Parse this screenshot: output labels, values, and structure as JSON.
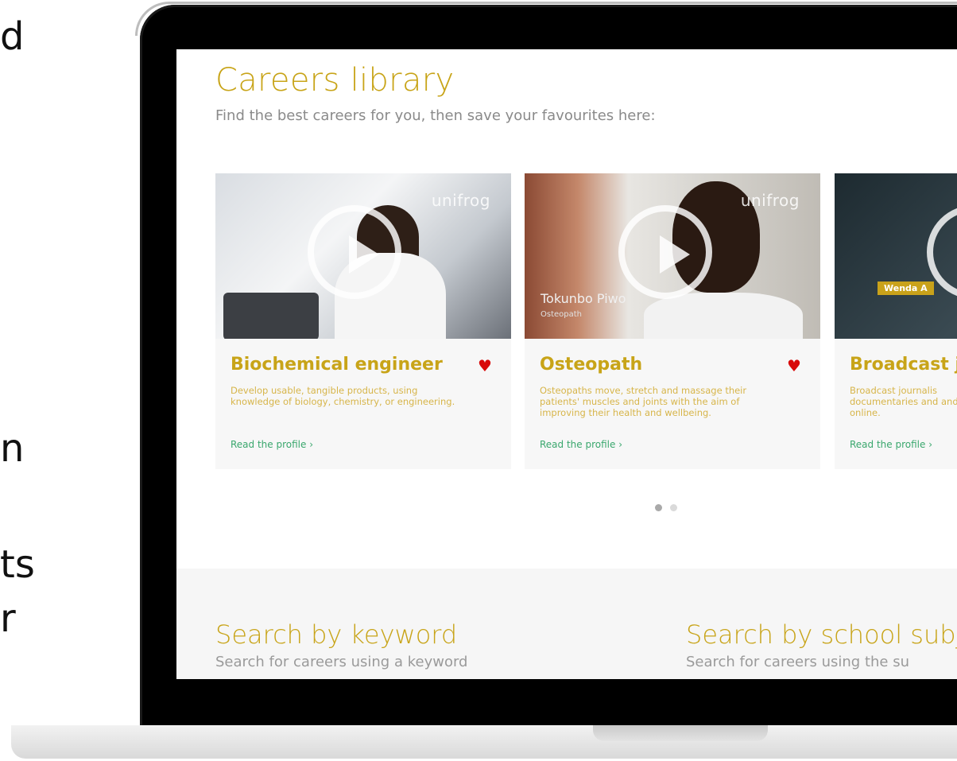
{
  "left_fragments": [
    "d",
    "n",
    "ts",
    "r"
  ],
  "page": {
    "title": "Careers library",
    "subtitle": "Find the best careers for you, then save your favourites here:"
  },
  "cards": [
    {
      "title": "Biochemical engineer",
      "description": "Develop usable, tangible products, using knowledge of biology, chemistry, or engineering.",
      "link": "Read the profile ›",
      "brand": "unifrog",
      "favourite": true
    },
    {
      "title": "Osteopath",
      "description": "Osteopaths move, stretch and massage their patients' muscles and joints with the aim of improving their health and wellbeing.",
      "link": "Read the profile ›",
      "brand": "unifrog",
      "video_caption_name": "Tokunbo Piwo",
      "video_caption_role": "Osteopath",
      "favourite": true
    },
    {
      "title": "Broadcast j",
      "description": "Broadcast journalis documentaries and and online.",
      "link": "Read the profile ›",
      "video_caption_name": "Wenda A"
    }
  ],
  "carousel": {
    "pages": 2,
    "current": 1
  },
  "search": {
    "keyword": {
      "title": "Search by keyword",
      "subtitle": "Search for careers using a keyword"
    },
    "subject": {
      "title": "Search by school subj",
      "subtitle": "Search for careers using the su"
    }
  },
  "colors": {
    "accent": "#c8a418",
    "link": "#3aa76d",
    "heart": "#d80a0a"
  }
}
